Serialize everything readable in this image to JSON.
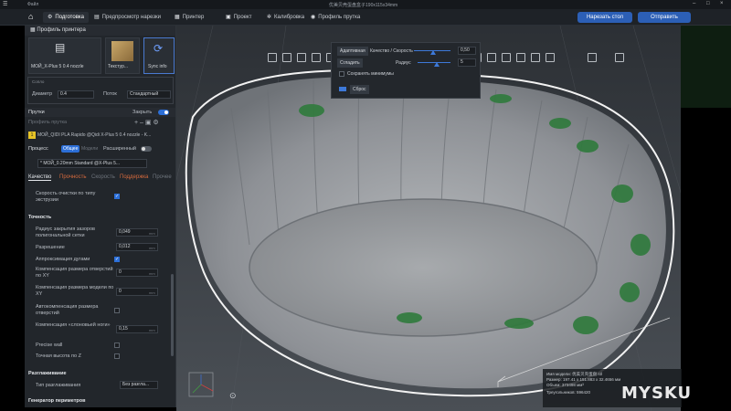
{
  "titlebar": {
    "menu": "Файл",
    "title": "优美贝壳蛋盘盒子190x115x34mm"
  },
  "tabs": [
    {
      "label": "Подготовка",
      "icon": "sliders-icon",
      "active": true
    },
    {
      "label": "Предпросмотр нарезки",
      "icon": "preview-icon",
      "active": false
    },
    {
      "label": "Принтер",
      "icon": "printer-icon",
      "active": false
    },
    {
      "label": "Проект",
      "icon": "project-icon",
      "active": false
    },
    {
      "label": "Калибровка",
      "icon": "calibration-icon",
      "active": false
    },
    {
      "label": "Профиль прутка",
      "icon": "filament-icon",
      "active": false
    }
  ],
  "actions": {
    "slice": "Нарезать стол",
    "send": "Отправить"
  },
  "printer": {
    "section": "Профиль принтера",
    "name": "МОЙ_X-Plus 5 0.4 nozzle",
    "plate": "Текстур...",
    "sync": "Sync info",
    "diameter_label": "Диаметр",
    "diameter_value": "0.4",
    "flow_label": "Поток",
    "flow_value": "Стандартный",
    "group_label": "Сопло"
  },
  "filament": {
    "section": "Прутки",
    "close_label": "Закрыть",
    "profile_label": "Профиль прутка",
    "slot": "1",
    "name": "МОЙ_QIDI PLA Rapido @Qidi X-Plus 5 0.4 nozzle - K..."
  },
  "process": {
    "label": "Процесс",
    "mode_basic": "Общее",
    "mode_model": "Модели",
    "advanced": "Расширенный",
    "profile": "* МОЙ_0.20mm Standard @X-Plus 5...",
    "subtabs": [
      "Качество",
      "Прочность",
      "Скорость",
      "Поддержка",
      "Прочее"
    ]
  },
  "settings": {
    "wipe_label": "Скорость очистки по типу экструзии",
    "accuracy_title": "Точность",
    "rows": [
      {
        "label": "Радиус закрытия зазоров полигональной сетки",
        "value": "0,049",
        "unit": "mm"
      },
      {
        "label": "Разрешение",
        "value": "0,012",
        "unit": "mm"
      },
      {
        "label": "Аппроксимация дугами",
        "value": ""
      },
      {
        "label": "Компенсация размера отверстий по XY",
        "value": "0",
        "unit": "mm"
      },
      {
        "label": "Компенсация размера модели по XY",
        "value": "0",
        "unit": "mm"
      },
      {
        "label": "Автокомпенсация размера отверстий",
        "value": ""
      },
      {
        "label": "Компенсация «слоновьей ноги»",
        "value": "0,15",
        "unit": "mm"
      },
      {
        "label": "Precise wall",
        "value": ""
      },
      {
        "label": "Точная высота по Z",
        "value": ""
      }
    ],
    "seam_title": "Разглаживание",
    "seam_label": "Тип разглаживания",
    "seam_value": "Без разгла...",
    "perimeter_title": "Генератор периметров"
  },
  "popover": {
    "adaptive": "Адаптивная",
    "quality_speed": "Качество / Скорость",
    "qs_value": "0,50",
    "smooth": "Сгладить",
    "radius": "Радиус",
    "radius_value": "5",
    "keep_min": "Сохранять минимумы",
    "reset": "Сброс"
  },
  "model_info": {
    "name": "Имя модели: 优美贝壳蛋盘.stl",
    "size": "Размер: 197.41 x 151.883 x 32.4656 мм",
    "volume": "Объем: 373498 мм³",
    "triangles": "Треугольников: 596420"
  },
  "watermark": "MYSKU",
  "colors": {
    "accent": "#2c5fb6",
    "model": "#9c9fa3",
    "highlight": "#2f7a3c"
  }
}
